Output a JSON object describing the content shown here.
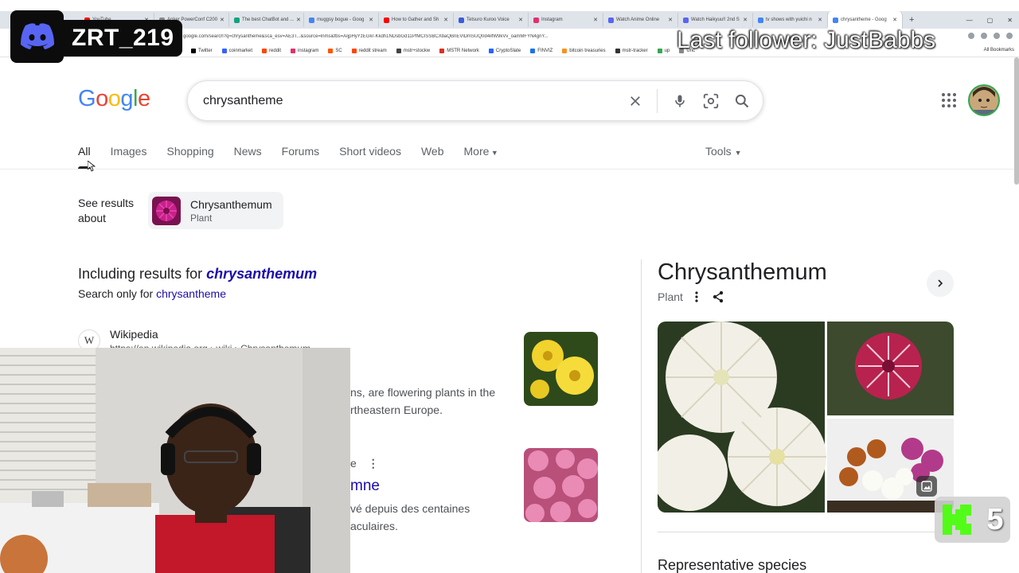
{
  "browser": {
    "tabs": [
      {
        "label": "YouTube",
        "color": "#ff0000"
      },
      {
        "label": "Anker PowerConf C200",
        "color": "#888888"
      },
      {
        "label": "The best ChatBot and ...",
        "color": "#10a37f"
      },
      {
        "label": "muggsy bogue - Goog",
        "color": "#4285f4"
      },
      {
        "label": "How to Gather and Sh",
        "color": "#ff0000"
      },
      {
        "label": "Tetsuro Kuroo Voice",
        "color": "#3b5bdb"
      },
      {
        "label": "Instagram",
        "color": "#e1306c"
      },
      {
        "label": "Watch Anime Online",
        "color": "#5865f2"
      },
      {
        "label": "Watch Haikyuu!! 2nd S",
        "color": "#5865f2"
      },
      {
        "label": "tv shows with yuichi n",
        "color": "#4285f4"
      },
      {
        "label": "chrysantheme - Goog",
        "color": "#4285f4",
        "active": true
      }
    ],
    "url": "google.com/search?q=chrysantheme&sca_esv=AE3T...&source=lnms&fbs=AIjpHyYzEGkr-Kkdh1NDsbGd11PfMCISSBCXbaQBnEVlDmSUQ0d4ilfW9kVv_oamMFYN4gnY...",
    "bookmarks": [
      {
        "label": "Twitter",
        "color": "#000000"
      },
      {
        "label": "coinmarket",
        "color": "#3861fb"
      },
      {
        "label": "reddit",
        "color": "#ff4500"
      },
      {
        "label": "instagram",
        "color": "#e1306c"
      },
      {
        "label": "SC",
        "color": "#ff5500"
      },
      {
        "label": "reddit stream",
        "color": "#ff4500"
      },
      {
        "label": "mstr+stockw",
        "color": "#444444"
      },
      {
        "label": "MSTR Network",
        "color": "#d93025"
      },
      {
        "label": "CryptoSlate",
        "color": "#2962ff"
      },
      {
        "label": "FINVIZ",
        "color": "#1a73e8"
      },
      {
        "label": "bitcoin treasuries",
        "color": "#f7931a"
      },
      {
        "label": "mstr-tracker",
        "color": "#333333"
      },
      {
        "label": "up",
        "color": "#34a853"
      },
      {
        "label": "Unc",
        "color": "#888888"
      }
    ],
    "all_bookmarks": "All Bookmarks"
  },
  "overlay": {
    "discord_name": "ZRT_219",
    "last_follower": "Last follower: JustBabbs",
    "kick_count": "5"
  },
  "google": {
    "logo": [
      "G",
      "o",
      "o",
      "g",
      "l",
      "e"
    ],
    "logo_colors": [
      "#4285f4",
      "#ea4335",
      "#fbbc05",
      "#4285f4",
      "#34a853",
      "#ea4335"
    ],
    "query": "chrysantheme",
    "tabs": [
      "All",
      "Images",
      "Shopping",
      "News",
      "Forums",
      "Short videos",
      "Web",
      "More"
    ],
    "tools": "Tools",
    "see_results_about": "See results about",
    "entity": {
      "name": "Chrysanthemum",
      "type": "Plant"
    },
    "including_prefix": "Including results for",
    "including_term": "chrysanthemum",
    "search_only_prefix": "Search only for",
    "search_only_term": "chrysantheme",
    "results": [
      {
        "site": "Wikipedia",
        "url": "https://en.wikipedia.org › wiki › Chrysanthemum",
        "snippet": "ns, are flowering plants in the rtheastern Europe."
      },
      {
        "site": "e",
        "title": "mne",
        "snippet": "vé depuis des centaines aculaires."
      }
    ]
  },
  "knowledge_panel": {
    "title": "Chrysanthemum",
    "subtitle": "Plant",
    "section": "Representative species"
  }
}
